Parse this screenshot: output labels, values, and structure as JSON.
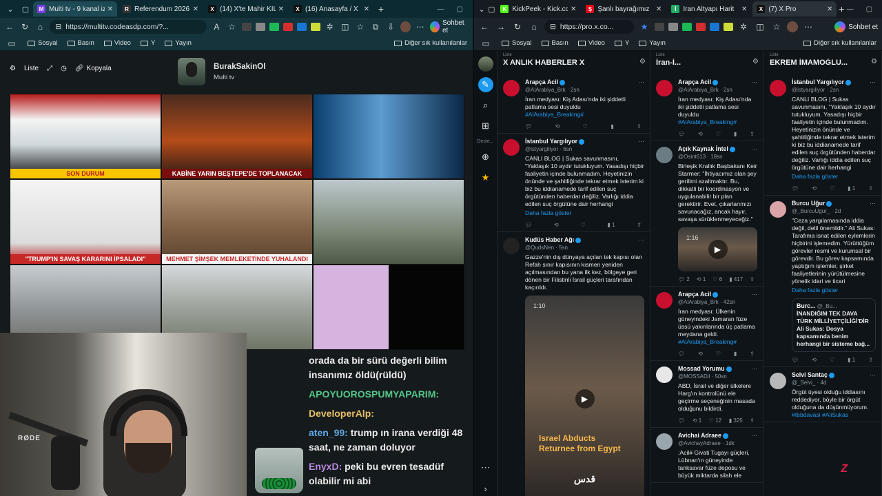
{
  "left_window": {
    "tabs": [
      {
        "label": "Multi tv - 9 kanal izlenir",
        "fav": "M",
        "color": "#7b3fe4",
        "active": true
      },
      {
        "label": "Referendum 2026, ogg",
        "fav": "R",
        "color": "#333333",
        "active": false
      },
      {
        "label": "(14) X'te Mahir KILIÇ: \"O",
        "fav": "X",
        "color": "#111111",
        "active": false
      },
      {
        "label": "(16) Anasayfa / X",
        "fav": "X",
        "color": "#111111",
        "active": false
      }
    ],
    "url": "https://multitv.codeasdp.com/?...",
    "chat_button": "Sohbet et",
    "bookmarks": [
      "Sosyal",
      "Basın",
      "Video",
      "Y",
      "Yayın"
    ],
    "bookmarks_other": "Diğer sık kullanılanlar"
  },
  "right_window": {
    "tabs": [
      {
        "label": "KickPeek - Kick.co",
        "fav": "K",
        "color": "#53fc18",
        "active": false
      },
      {
        "label": "Şanlı bayrağımız",
        "fav": "Ş",
        "color": "#e30a17",
        "active": false
      },
      {
        "label": "İran Altyapı Harit",
        "fav": "İ",
        "color": "#2a6",
        "active": false
      },
      {
        "label": "(7) X Pro",
        "fav": "X",
        "color": "#111111",
        "active": true
      }
    ],
    "url": "https://pro.x.co...",
    "chat_button": "Sohbet et",
    "bookmarks": [
      "Sosyal",
      "Basın",
      "Video",
      "Y",
      "Yayın"
    ],
    "bookmarks_other": "Diğer sık kullanılanlar"
  },
  "multitv": {
    "controls": {
      "list": "Liste",
      "copy": "Kopyala"
    },
    "profile": {
      "name": "BurakSakinOl",
      "subtitle": "Multi tv"
    },
    "channels": [
      {
        "caption": "SON DURUM",
        "bg": "linear-gradient(#b71c1c 0%,#f3f3f3 30%,#cfd8dc 60%,#111 100%)",
        "cap_bg": "#f7c600",
        "cap_color": "#b71c1c"
      },
      {
        "caption": "KABİNE YARIN BEŞTEPE'DE TOPLANACAK",
        "bg": "linear-gradient(#4b2b1f,#b44c1a 55%,#2a1a14 100%)",
        "cap_bg": "#7a0d0d",
        "cap_color": "#ffffff"
      },
      {
        "caption": "",
        "bg": "linear-gradient(90deg,#0a3f6e,#5d9bd0 45%,#0a2846)",
        "cap_bg": "#b00020",
        "cap_color": "#ffffff"
      },
      {
        "caption": "\"TRUMP'IN SAVAŞ KARARINI İPSALADI\"",
        "bg": "linear-gradient(#f4f4f4,#dcdcdc 75%,#b71c1c 100%)",
        "cap_bg": "#c62828",
        "cap_color": "#ffffff"
      },
      {
        "caption": "MEHMET ŞİMŞEK MEMLEKETİNDE YUHALANDI",
        "bg": "linear-gradient(#b89a7a,#7f5f44 60%,#5a4330)",
        "cap_bg": "#f5f5f5",
        "cap_color": "#c62828"
      },
      {
        "caption": "",
        "bg": "linear-gradient(#bcc7cc,#7d8a78 60%,#4d5a48)",
        "cap_bg": "transparent",
        "cap_color": "#ffffff"
      },
      {
        "caption": "",
        "bg": "linear-gradient(#c7ccd0,#8e9396 55%,#6a6a62)",
        "cap_bg": "transparent",
        "cap_color": "#ffffff"
      },
      {
        "caption": "",
        "bg": "linear-gradient(#d5d9dc,#9ea39c 50%,#6f7566)",
        "cap_bg": "transparent",
        "cap_color": "#ffffff"
      },
      {
        "caption": "",
        "bg": "linear-gradient(90deg,#d5b4e0 0 50%,#050505 50% 100%)",
        "cap_bg": "transparent",
        "cap_color": "#ffffff"
      }
    ]
  },
  "webcam": {
    "mic_brand": "RØDE"
  },
  "chat": [
    {
      "user": "",
      "text": "orada da bir sürü değerli bilim insanımız öldü(rüldü)",
      "cls": ""
    },
    {
      "user": "APOYUOROSPUMYAPARIM:",
      "text": "",
      "cls": "u1"
    },
    {
      "user": "DeveloperAlp:",
      "text": "",
      "cls": "u2"
    },
    {
      "user": "aten_99:",
      "text": "trump ın irana verdiği 48 saat, ne zaman doluyor",
      "cls": "u3"
    },
    {
      "user": "EnyxD:",
      "text": "peki bu evren tesadüf olabilir mi abi",
      "cls": "u4"
    }
  ],
  "tweetdeck": {
    "rail_label": "Deste...",
    "columns": [
      {
        "list": "Liste",
        "title": "X ANLIK HABERLER X",
        "tweets": [
          {
            "name": "Arapça Acil",
            "handle": "@AlArabiya_Brk · 2sn",
            "text": "İran medyası: Kiş Adası'nda iki şiddetli patlama sesi duyuldu",
            "hashtag": "#AlArabiya_Breaking#",
            "avatar": "#c8102e",
            "acts": [
              "",
              "",
              "",
              "",
              ""
            ]
          },
          {
            "name": "İstanbul Yargılıyor",
            "handle": "@istyargiliyor · 6sn",
            "text": "CANLI BLOG | Sukas savunmasını, \"Yaklaşık 10 aydır tutukluyum. Yasadışı hiçbir faaliyetin içinde bulunmadım. Heyetinizin önünde ve şahitliğinde tekrar etmek isterim ki biz bu iddianamede tarif edilen suç örgütünden haberdar değiliz. Varlığı iddia edilen suç örgütüne dair herhangi",
            "link": "Daha fazla göster",
            "avatar": "#c8102e",
            "acts": [
              "",
              "",
              "",
              "1",
              ""
            ]
          },
          {
            "name": "Kudüs Haber Ağı",
            "handle": "@QudsNen · 5sn",
            "text": "Gazze'nin dış dünyaya açılan tek kapısı olan Refah sınır kapısının kısmen yeniden açılmasından bu yana ilk kez, bölgeye geri dönen bir Filistinli İsrail güçleri tarafından kaçırıldı.",
            "avatar": "#222222",
            "media": {
              "duration": "1:10",
              "caption": "Israel Abducts Returnee from Egypt",
              "logo": "قدس",
              "height": 300
            }
          }
        ]
      },
      {
        "list": "Liste",
        "title": "İran-İ...",
        "tweets": [
          {
            "name": "Arapça Acil",
            "handle": "@AlArabiya_Brk · 2sn",
            "text": "İran medyası: Kiş Adası'nda iki şiddetli patlama sesi duyuldu",
            "hashtag": "#AlArabiya_Breaking#",
            "avatar": "#c8102e",
            "acts": [
              "",
              "",
              "",
              "",
              ""
            ]
          },
          {
            "name": "Açık Kaynak İntel",
            "handle": "@Osint613 · 18sn",
            "text": "Birleşik Krallık Başbakanı Keir Starmer: \"İhtiyacımız olan şey gerilimi azaltmaktır. Bu, dikkatli bir koordinasyon ve uygulanabilir bir plan gerektirir. Evet, çıkarlarımızı savunacağız, ancak hayır, savaşa sürüklenmeyeceğiz.\"",
            "avatar": "#6b7c85",
            "media": {
              "duration": "1:16",
              "caption": "",
              "logo": "",
              "height": 64
            },
            "acts": [
              "2",
              "1",
              "6",
              "417",
              ""
            ]
          },
          {
            "name": "Arapça Acil",
            "handle": "@AlArabiya_Brk · 42sn",
            "text": "İran medyası: Ülkenin güneyindeki Jamaran füze üssü yakınlarında üç patlama meydana geldi.",
            "hashtag": "#AlArabiya_Breaking#",
            "avatar": "#c8102e",
            "acts": [
              "",
              "",
              "",
              "",
              ""
            ]
          },
          {
            "name": "Mossad Yorumu",
            "handle": "@MOSSADil · 50sn",
            "text": "ABD, İsrail ve diğer ülkelere Harg'ın kontrolünü ele geçirme seçeneğinin masada olduğunu bildirdi.",
            "avatar": "#e7e7e7",
            "acts": [
              "",
              "1",
              "12",
              "325",
              ""
            ]
          },
          {
            "name": "Avichai Adraee",
            "handle": "@AvichayAdraee · 1dk",
            "text": ":Acil# Givati Tugayı güçleri, Lübnan'ın güneyinde tanksavar füze deposu ve büyük miktarda silah ele",
            "avatar": "#9aa6ad"
          }
        ]
      },
      {
        "list": "Liste",
        "title": "EKREM İMAMOĞLU...",
        "tweets": [
          {
            "name": "İstanbul Yargılıyor",
            "handle": "@istyargiliyor · 2sn",
            "text": "CANLI BLOG | Sukas savunmasını, \"Yaklaşık 10 aydır tutukluyum. Yasadışı hiçbir faaliyetin içinde bulunmadım. Heyetinizin önünde ve şahitliğinde tekrar etmek isterim ki biz bu iddianamede tarif edilen suç örgütünden haberdar değiliz. Varlığı iddia edilen suç örgütüne dair herhangi",
            "link": "Daha fazla göster",
            "avatar": "#c8102e",
            "acts": [
              "",
              "",
              "",
              "1",
              ""
            ]
          },
          {
            "name": "Burcu Uğur",
            "handle": "@_BurcuUgur_ · 2d",
            "text": "\"Ceza yargılamasında iddia değil, delil önemlidir.\" Ali Sukas: Tarafıma isnat edilen eylemlerin hiçbirini işlemedim. Yürüttüğüm görevler resmi ve kurumsal bir görevdir. Bu görev kapsamında yaptığım işlemler, şirket faaliyetlerinin yürütülmesine yönelik idari ve ticari",
            "link": "Daha fazla göster",
            "avatar": "#d9a3a8",
            "quote": {
              "name": "Burc...",
              "handle": "@_Bu...",
              "text": "İNANDIĞIM TEK DAVA TÜRK MİLLİYETÇİLİĞİ'DİR Ali Sukas: Dosya kapsamında benim herhangi bir sisteme bağ..."
            },
            "acts": [
              "",
              "",
              "",
              "1",
              ""
            ]
          },
          {
            "name": "Selvi Santaç",
            "handle": "@_Selvi_ · 4d",
            "text": "Örgüt üyesi olduğu iddiasını reddediyor, böyle bir örgüt olduğuna da düşünmüyorum.",
            "hashtag": "#Ibbdavasi #AliSukas",
            "avatar": "#b8b8b8"
          }
        ]
      }
    ]
  }
}
